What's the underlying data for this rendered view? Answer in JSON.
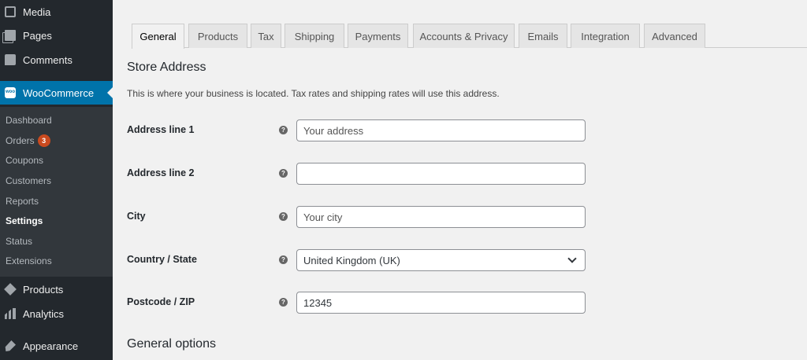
{
  "sidebar": {
    "top_items": [
      {
        "label": "Media",
        "icon": "media-icon"
      },
      {
        "label": "Pages",
        "icon": "pages-icon"
      },
      {
        "label": "Comments",
        "icon": "comments-icon"
      }
    ],
    "woocommerce": {
      "label": "WooCommerce",
      "icon": "woocommerce-icon"
    },
    "submenu": [
      {
        "label": "Dashboard"
      },
      {
        "label": "Orders",
        "badge": "3"
      },
      {
        "label": "Coupons"
      },
      {
        "label": "Customers"
      },
      {
        "label": "Reports"
      },
      {
        "label": "Settings",
        "current": true
      },
      {
        "label": "Status"
      },
      {
        "label": "Extensions"
      }
    ],
    "bottom_items": [
      {
        "label": "Products",
        "icon": "products-icon"
      },
      {
        "label": "Analytics",
        "icon": "analytics-icon"
      },
      {
        "label": "Appearance",
        "icon": "appearance-icon"
      }
    ]
  },
  "tabs": [
    {
      "label": "General",
      "active": true
    },
    {
      "label": "Products"
    },
    {
      "label": "Tax"
    },
    {
      "label": "Shipping"
    },
    {
      "label": "Payments"
    },
    {
      "label": "Accounts & Privacy"
    },
    {
      "label": "Emails"
    },
    {
      "label": "Integration"
    },
    {
      "label": "Advanced"
    }
  ],
  "store_address": {
    "heading": "Store Address",
    "description": "This is where your business is located. Tax rates and shipping rates will use this address.",
    "fields": [
      {
        "label": "Address line 1",
        "value": "",
        "placeholder": "Your address"
      },
      {
        "label": "Address line 2",
        "value": "",
        "placeholder": ""
      },
      {
        "label": "City",
        "value": "",
        "placeholder": "Your city"
      },
      {
        "label": "Country / State",
        "value": "United Kingdom (UK)",
        "type": "select"
      },
      {
        "label": "Postcode / ZIP",
        "value": "12345",
        "placeholder": ""
      }
    ]
  },
  "general_options": {
    "heading": "General options"
  },
  "help_glyph": "?",
  "colors": {
    "sidebar_bg": "#23282d",
    "submenu_bg": "#32373c",
    "accent": "#0073aa",
    "badge": "#ca4a1f",
    "page_bg": "#f1f1f1"
  }
}
